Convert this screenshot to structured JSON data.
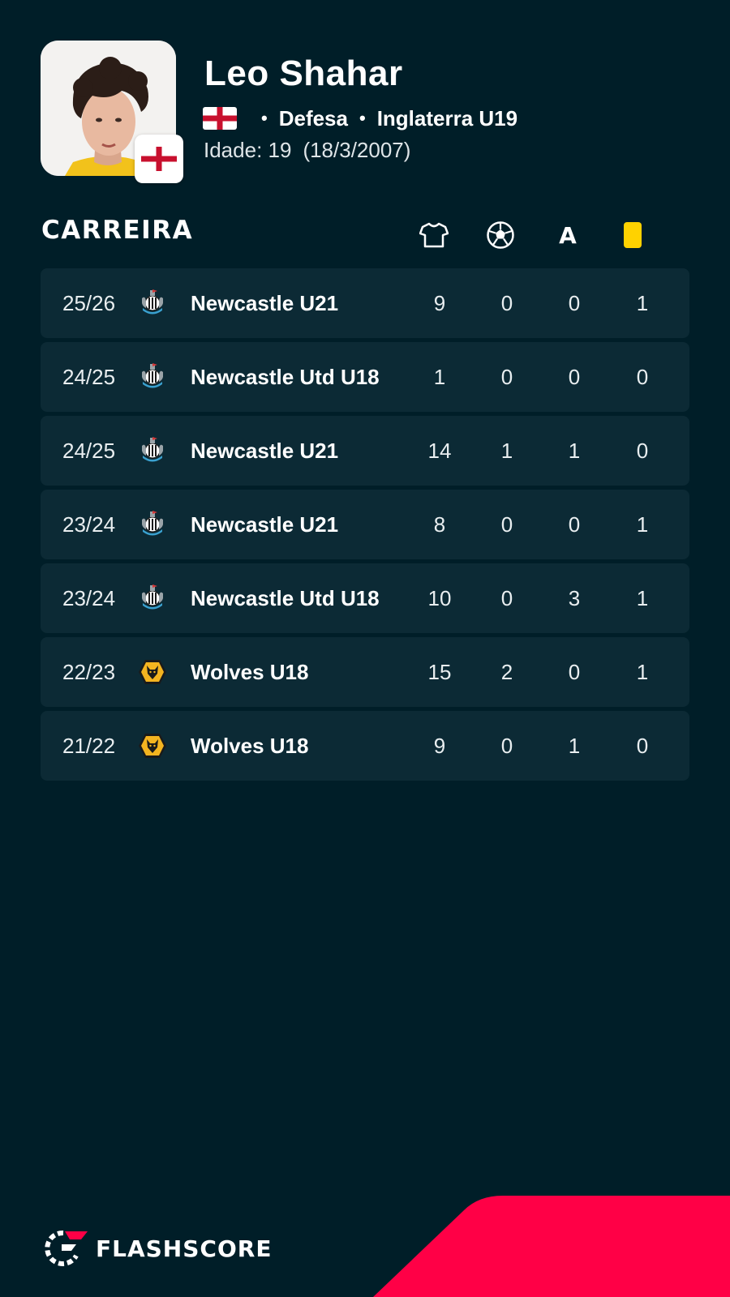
{
  "player": {
    "name": "Leo Shahar",
    "position": "Defesa",
    "team": "Inglaterra U19",
    "age_label": "Idade: 19",
    "birthdate": "(18/3/2007)"
  },
  "section": {
    "title": "CARREIRA"
  },
  "columns": [
    {
      "icon": "jersey-icon"
    },
    {
      "icon": "ball-icon"
    },
    {
      "icon": "assist-icon",
      "label": "A"
    },
    {
      "icon": "yellow-card-icon"
    }
  ],
  "career": [
    {
      "season": "25/26",
      "club": "Newcastle U21",
      "logo": "newcastle-logo",
      "apps": "9",
      "goals": "0",
      "assists": "0",
      "yellow": "1"
    },
    {
      "season": "24/25",
      "club": "Newcastle Utd U18",
      "logo": "newcastle-logo",
      "apps": "1",
      "goals": "0",
      "assists": "0",
      "yellow": "0"
    },
    {
      "season": "24/25",
      "club": "Newcastle U21",
      "logo": "newcastle-logo",
      "apps": "14",
      "goals": "1",
      "assists": "1",
      "yellow": "0"
    },
    {
      "season": "23/24",
      "club": "Newcastle U21",
      "logo": "newcastle-logo",
      "apps": "8",
      "goals": "0",
      "assists": "0",
      "yellow": "1"
    },
    {
      "season": "23/24",
      "club": "Newcastle Utd U18",
      "logo": "newcastle-logo",
      "apps": "10",
      "goals": "0",
      "assists": "3",
      "yellow": "1"
    },
    {
      "season": "22/23",
      "club": "Wolves U18",
      "logo": "wolves-logo",
      "apps": "15",
      "goals": "2",
      "assists": "0",
      "yellow": "1"
    },
    {
      "season": "21/22",
      "club": "Wolves U18",
      "logo": "wolves-logo",
      "apps": "9",
      "goals": "0",
      "assists": "1",
      "yellow": "0"
    }
  ],
  "brand": {
    "name": "FLASHSCORE"
  },
  "colors": {
    "background": "#001e28",
    "row_background": "#0c2a35",
    "accent": "#ff0046",
    "yellow_card": "#ffd200"
  }
}
